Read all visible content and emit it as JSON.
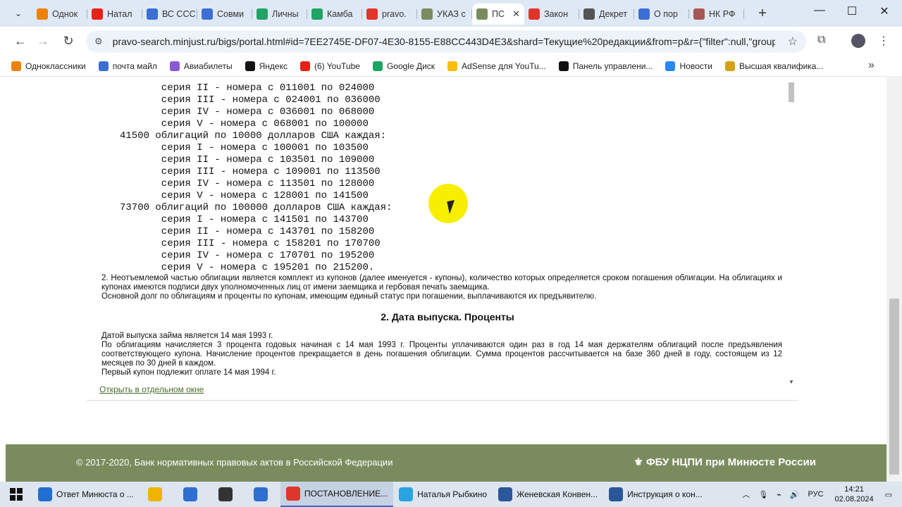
{
  "browser": {
    "tabs": [
      {
        "label": "Однок",
        "icon": "ok-icon",
        "color": "#ee8208"
      },
      {
        "label": "Натал",
        "icon": "youtube-icon",
        "color": "#e62117"
      },
      {
        "label": "ВС ССС",
        "icon": "doc-icon",
        "color": "#3b6fd4"
      },
      {
        "label": "Совми",
        "icon": "doc-icon",
        "color": "#3b6fd4"
      },
      {
        "label": "Личны",
        "icon": "drive-icon",
        "color": "#1fa463"
      },
      {
        "label": "Камба",
        "icon": "drive-icon",
        "color": "#1fa463"
      },
      {
        "label": "pravo.",
        "icon": "yandex-icon",
        "color": "#e0352b"
      },
      {
        "label": "УКАЗ с",
        "icon": "emblem-icon",
        "color": "#7a8c5e"
      },
      {
        "label": "ПС",
        "icon": "emblem-icon",
        "color": "#7a8c5e",
        "active": true
      },
      {
        "label": "Закон",
        "icon": "yandex-icon",
        "color": "#e0352b"
      },
      {
        "label": "Декрет",
        "icon": "web-icon",
        "color": "#555"
      },
      {
        "label": "О пор",
        "icon": "web-icon",
        "color": "#3b6fd4"
      },
      {
        "label": "НК РФ",
        "icon": "web-icon",
        "color": "#a55"
      }
    ],
    "url": "pravo-search.minjust.ru/bigs/portal.html#id=7EE2745E-DF07-4E30-8155-E88CC443D4E3&shard=Текущие%20редакции&from=p&r={\"filter\":null,\"groups\":[\"Теку...",
    "bookmarks": [
      {
        "label": "Одноклассники",
        "color": "#ee8208"
      },
      {
        "label": "почта майл",
        "color": "#3b6fd4"
      },
      {
        "label": "Авиабилеты",
        "color": "#8a5ad4"
      },
      {
        "label": "Яндекс",
        "color": "#111"
      },
      {
        "label": "(6) YouTube",
        "color": "#e62117"
      },
      {
        "label": "Google Диск",
        "color": "#1fa463"
      },
      {
        "label": "AdSense для YouTu...",
        "color": "#fbbc05"
      },
      {
        "label": "Панель управлени...",
        "color": "#111"
      },
      {
        "label": "Новости",
        "color": "#2787f5"
      },
      {
        "label": "Высшая квалифика...",
        "color": "#d4a017"
      }
    ]
  },
  "document": {
    "bond_lines": [
      "       серия II - номера с 011001 по 024000",
      "       серия III - номера с 024001 по 036000",
      "       серия IV - номера с 036001 по 068000",
      "       серия V - номера с 068001 по 100000",
      "41500 облигаций по 10000 долларов США каждая:",
      "       серия I - номера с 100001 по 103500",
      "       серия II - номера с 103501 по 109000",
      "       серия III - номера с 109001 по 113500",
      "       серия IV - номера с 113501 по 128000",
      "       серия V - номера с 128001 по 141500",
      "73700 облигаций по 100000 долларов США каждая:",
      "       серия I - номера с 141501 по 143700",
      "       серия II - номера с 143701 по 158200",
      "       серия III - номера с 158201 по 170700",
      "       серия IV - номера с 170701 по 195200",
      "       серия V - номера с 195201 по 215200."
    ],
    "para1": "   2. Неотъемлемой частью облигации является комплект из купонов (далее именуется - купоны), количество которых определяется сроком погашения облигации. На облигациях и купонах имеются подписи двух уполномоченных лиц от имени заемщика и гербовая печать заемщика.",
    "para2": "   Основной долг по облигациям и проценты по купонам, имеющим единый статус при погашении, выплачиваются их предъявителю.",
    "heading": "2. Дата выпуска. Проценты",
    "para3": "   Датой выпуска займа является 14 мая 1993 г.",
    "para4": "   По облигациям начисляется 3 процента годовых начиная с 14 мая 1993 г. Проценты уплачиваются один раз в год 14 мая держателям облигаций после предъявления соответствующего купона. Начисление процентов прекращается в день погашения облигации. Сумма процентов рассчитывается на базе 360 дней в году, состоящем из 12 месяцев по 30 дней в каждом.",
    "para5": "   Первый купон подлежит оплате 14 мая 1994 г.",
    "open_link": "Открыть в отдельном окне"
  },
  "footer": {
    "copyright": "© 2017-2020, Банк нормативных правовых актов в Российской Федерации",
    "org": "ФБУ НЦПИ при Минюсте России"
  },
  "taskbar": {
    "items": [
      {
        "label": "Ответ Минюста о ...",
        "color": "#1f6fd0",
        "icon": "edge-icon"
      },
      {
        "label": "",
        "color": "#f0b400",
        "icon": "folder-icon"
      },
      {
        "label": "",
        "color": "#2f6fd0",
        "icon": "store-icon"
      },
      {
        "label": "",
        "color": "#333",
        "icon": "obs-icon"
      },
      {
        "label": "",
        "color": "#2f6fd0",
        "icon": "mail-icon"
      },
      {
        "label": "ПОСТАНОВЛЕНИЕ...",
        "color": "#e0352b",
        "icon": "chrome-icon",
        "active": true
      },
      {
        "label": "Наталья Рыбкино",
        "color": "#2aa3e0",
        "icon": "telegram-icon"
      },
      {
        "label": "Женевская Конвен...",
        "color": "#2b579a",
        "icon": "word-icon"
      },
      {
        "label": "Инструкция о кон...",
        "color": "#2b579a",
        "icon": "word-icon"
      }
    ],
    "lang": "РУС",
    "time": "14:21",
    "date": "02.08.2024"
  }
}
